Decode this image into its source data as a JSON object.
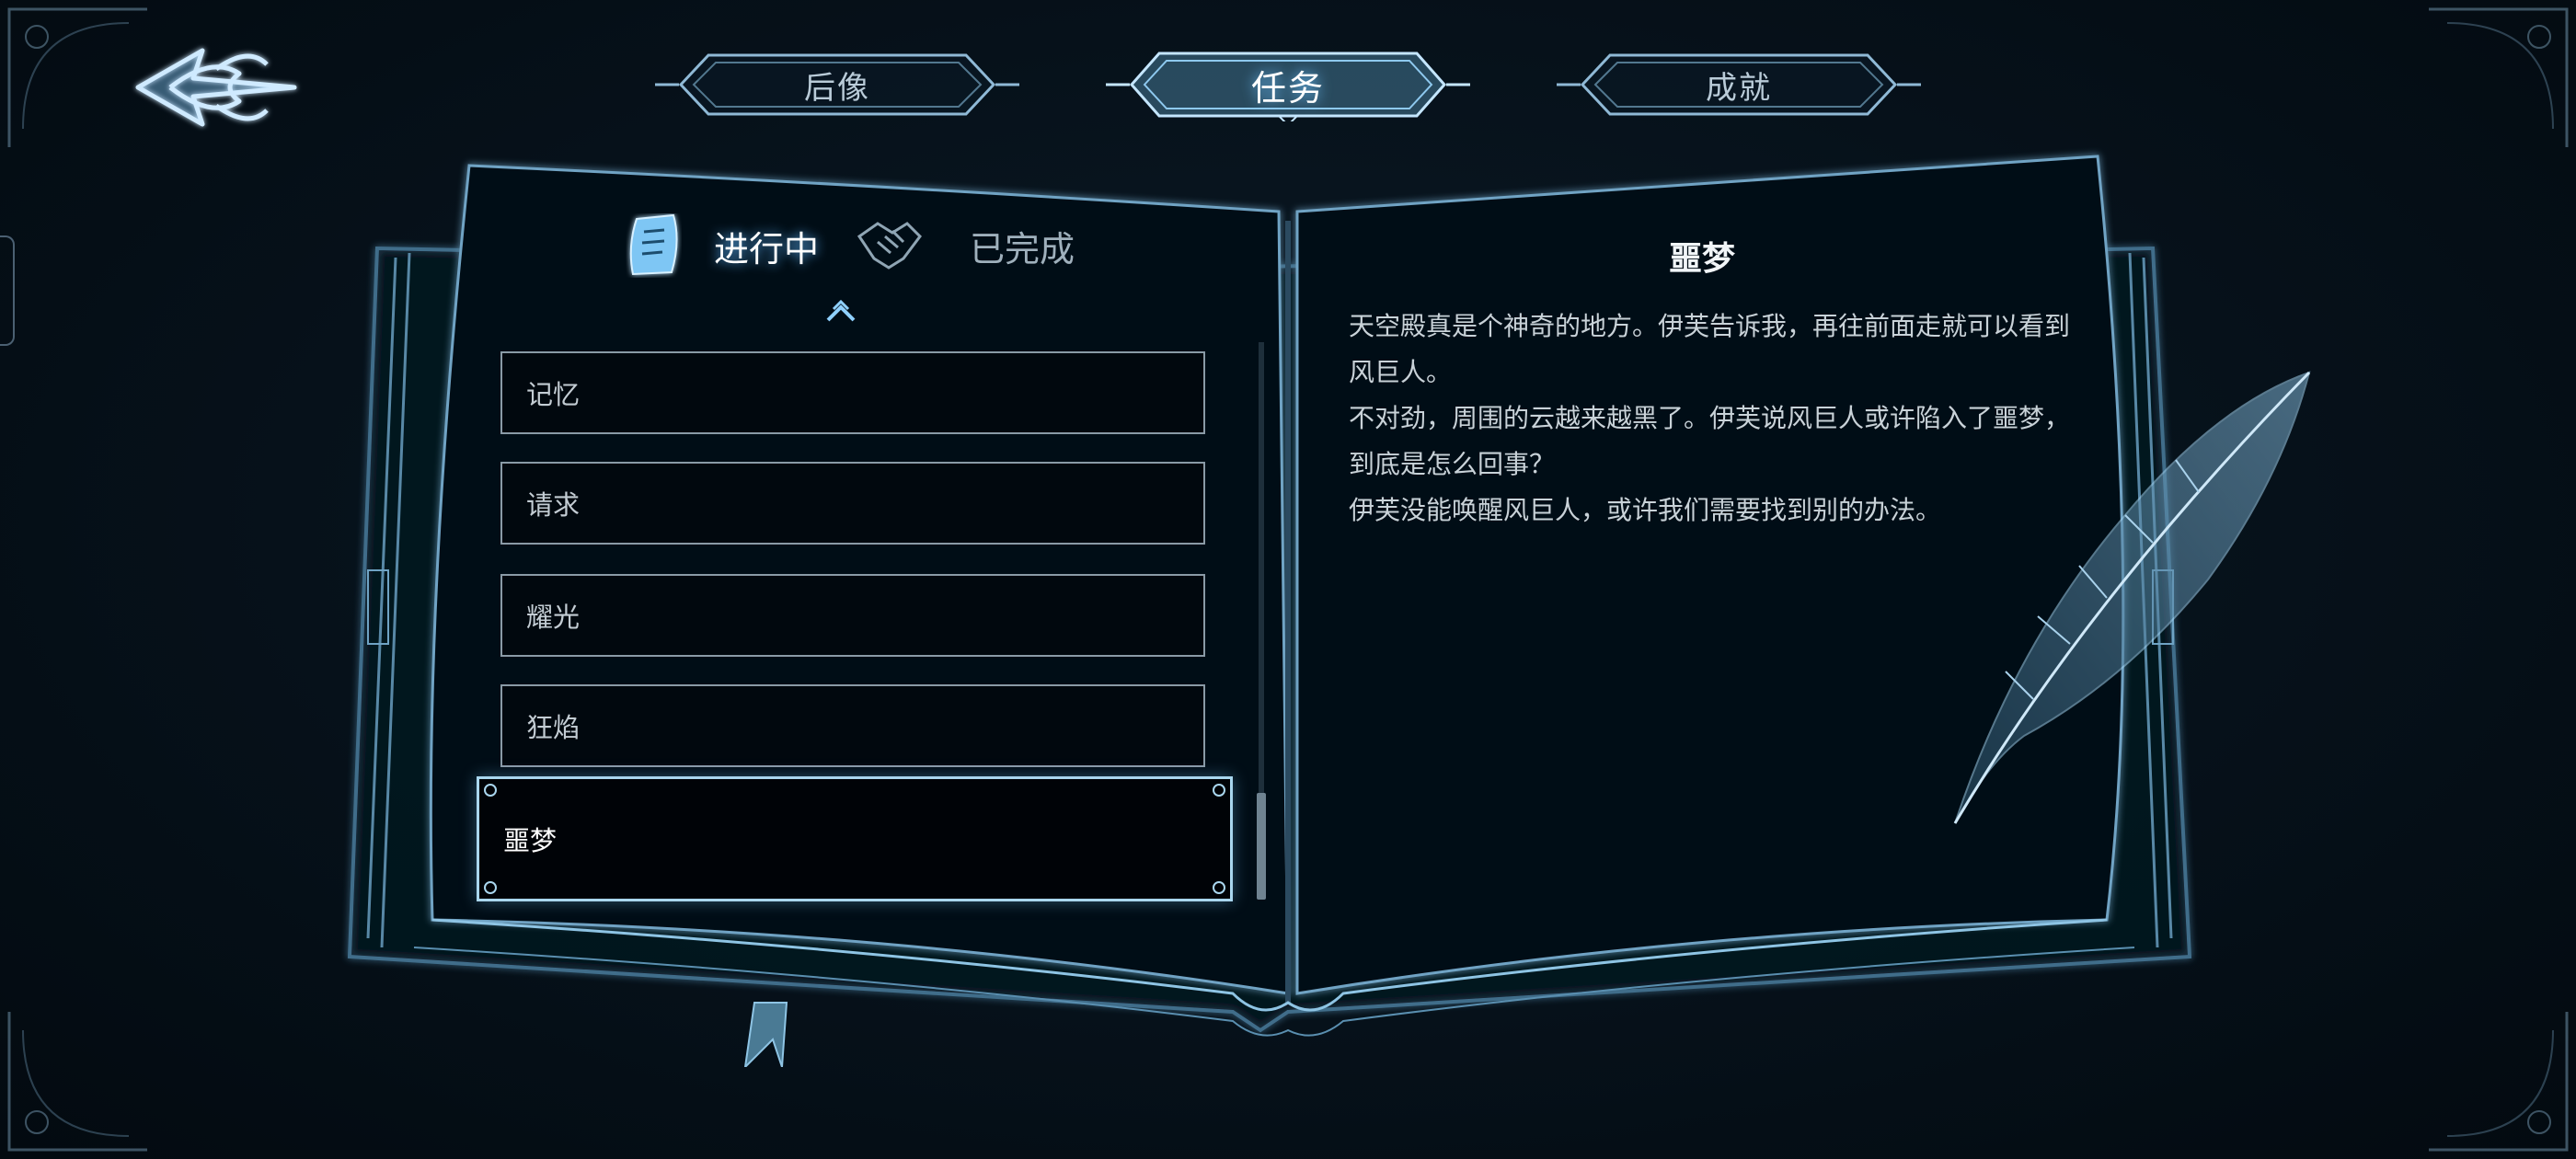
{
  "top_tabs": [
    {
      "label": "后像",
      "active": false
    },
    {
      "label": "任务",
      "active": true
    },
    {
      "label": "成就",
      "active": false
    }
  ],
  "quest_tabs": {
    "in_progress": "进行中",
    "completed": "已完成",
    "active": "in_progress"
  },
  "quests": [
    {
      "name": "记忆"
    },
    {
      "name": "请求"
    },
    {
      "name": "耀光"
    },
    {
      "name": "狂焰"
    },
    {
      "name": "噩梦",
      "selected": true
    }
  ],
  "detail": {
    "title": "噩梦",
    "paragraphs": [
      "天空殿真是个神奇的地方。伊芙告诉我，再往前面走就可以看到风巨人。",
      "不对劲，周围的云越来越黑了。伊芙说风巨人或许陷入了噩梦，到底是怎么回事？",
      "伊芙没能唤醒风巨人，或许我们需要找到别的办法。"
    ]
  },
  "icons": {
    "back": "back-arrow-icon",
    "scroll_up": "chevron-up-icon",
    "in_progress": "scroll-icon",
    "completed": "handshake-icon",
    "decoration": "quill-feather-icon"
  },
  "colors": {
    "background": "#06111a",
    "glow": "#6fc3ff",
    "border": "#8a9aa6",
    "text": "#c9d2d8"
  }
}
